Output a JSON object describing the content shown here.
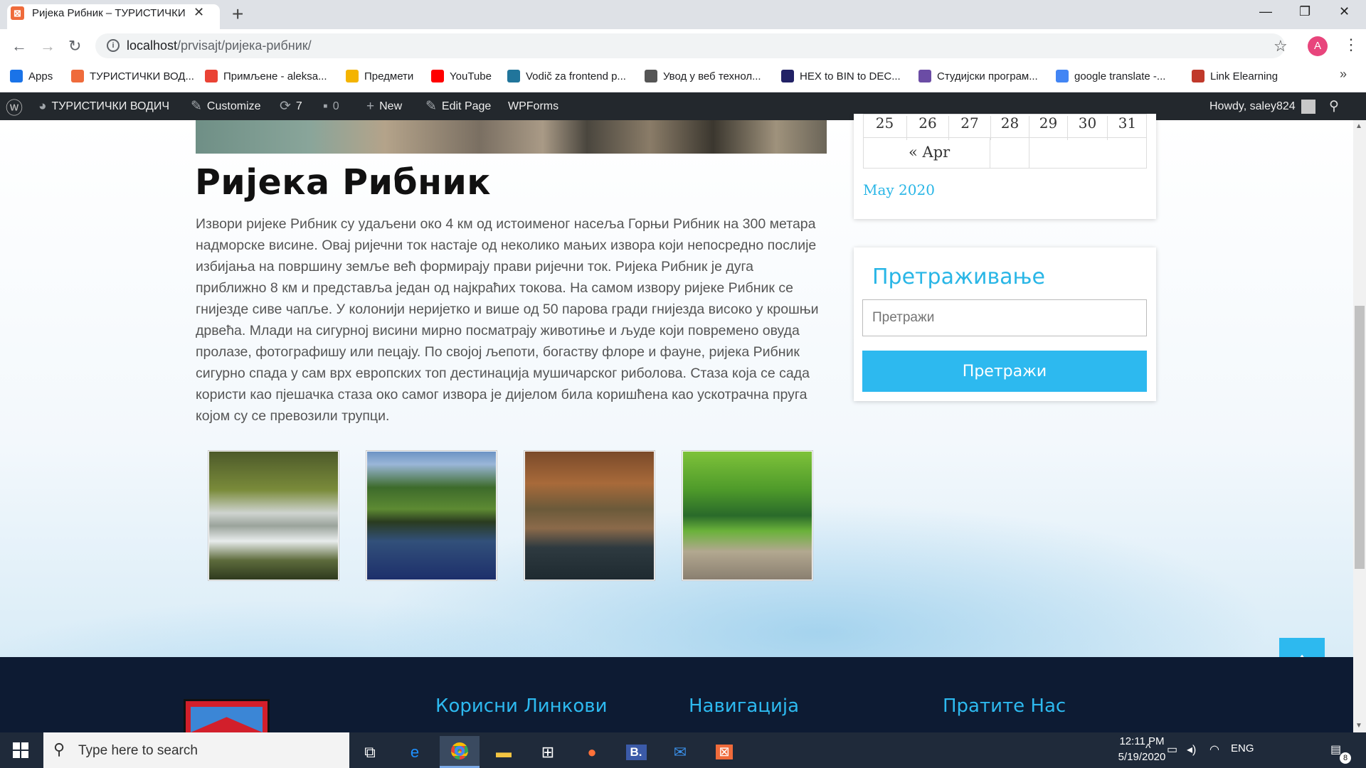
{
  "browser": {
    "tab_title": "Ријека Рибник – ТУРИСТИЧКИ ВОДИЧ",
    "url_host": "localhost",
    "url_path": "/prvisajt/ријека-рибник/",
    "avatar_letter": "A",
    "bookmarks": [
      {
        "label": "Apps",
        "icon": "apps-grid-icon",
        "color": "#1a73e8"
      },
      {
        "label": "ТУРИСТИЧКИ ВОД...",
        "icon": "xampp-icon",
        "color": "#ef6b3b"
      },
      {
        "label": "Примљене - aleksa...",
        "icon": "gmail-icon",
        "color": "#ea4335"
      },
      {
        "label": "Предмети",
        "icon": "classroom-icon",
        "color": "#f4b400"
      },
      {
        "label": "YouTube",
        "icon": "youtube-icon",
        "color": "#ff0000"
      },
      {
        "label": "Vodič za frontend p...",
        "icon": "wordpress-icon",
        "color": "#21759b"
      },
      {
        "label": "Увод у веб технол...",
        "icon": "globe-icon",
        "color": "#555555"
      },
      {
        "label": "HEX to BIN to DEC...",
        "icon": "hex-icon",
        "color": "#222266"
      },
      {
        "label": "Студијски програм...",
        "icon": "university-icon",
        "color": "#6b4ca5"
      },
      {
        "label": "google translate -...",
        "icon": "google-icon",
        "color": "#4285f4"
      },
      {
        "label": "Link Elearning",
        "icon": "elearning-icon",
        "color": "#c0392b"
      }
    ]
  },
  "adminbar": {
    "site_name": "ТУРИСТИЧКИ ВОДИЧ",
    "customize": "Customize",
    "updates": "7",
    "comments": "0",
    "new": "New",
    "edit_page": "Edit Page",
    "wpforms": "WPForms",
    "howdy": "Howdy, saley824"
  },
  "post": {
    "title": "Ријека Рибник",
    "body": "Извори ријеке Рибник су удаљени око 4 км од истоименог насеља Горњи Рибник на 300 метара надморске висине. Овај ријечни ток настаје од неколико мањих извора који непосредно послије избијања на површину земље већ формирају прави ријечни ток. Ријека Рибник је дуга приближно 8 км и представља један од најкраћих токова. На самом извору ријеке Рибник се гнијезде сиве чапље. У колонији неријетко и више од 50 парова гради гнијезда високо у крошњи дрвећа. Млади на сигурној висини мирно посматрају животиње и људе који повремено овуда пролазе, фотографишу или пецају. По својој љепоти, богаству флоре и фауне, ријека Рибник сигурно спада у сам врх европских топ дестинација мушичарског риболова. Стаза која се сада користи као пјешачка стаза око самог извора је дијелом била коришћена као ускотрачна пруга којом су се превозили трупци."
  },
  "calendar": {
    "days": [
      "25",
      "26",
      "27",
      "28",
      "29",
      "30",
      "31"
    ],
    "prev_link": "« Apr",
    "month_link": "May 2020"
  },
  "search": {
    "title": "Претраживање",
    "placeholder": "Претражи",
    "button": "Претражи"
  },
  "footer": {
    "headings": [
      "Корисни Линкови",
      "Навигација",
      "Пратите Нас"
    ]
  },
  "taskbar": {
    "search_placeholder": "Type here to search",
    "language": "ENG",
    "time": "12:11 PM",
    "date": "5/19/2020",
    "notifications": "8"
  },
  "colors": {
    "accent": "#2db9ef",
    "adminbar": "#23282d",
    "footer": "#0d1b33"
  }
}
